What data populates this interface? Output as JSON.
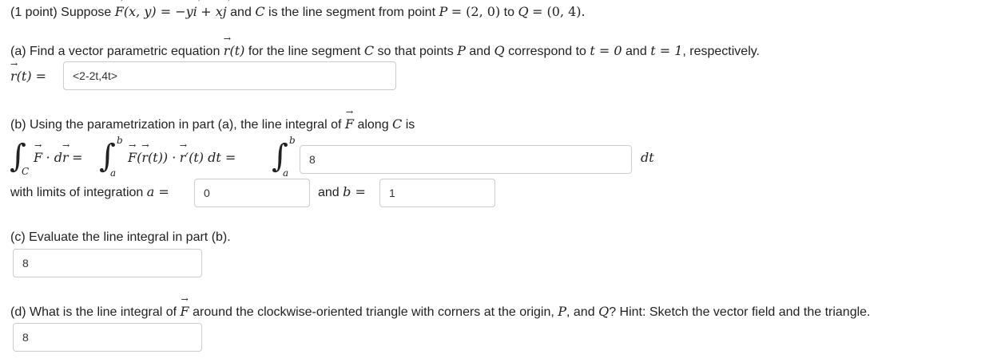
{
  "intro": {
    "points": "(1 point)",
    "suppose": "Suppose",
    "field": "F",
    "field_args": "(x, y) = −y",
    "i": "i",
    "plus": "+ x",
    "j": "j",
    "and": "and",
    "curve": "C",
    "is_segment": "is the line segment from point",
    "P": "P",
    "p_val": "= (2, 0)",
    "to": "to",
    "Q": "Q",
    "q_val": "= (0, 4)."
  },
  "part_a": {
    "prompt_start": "(a) Find a vector parametric equation",
    "r": "r",
    "t_arg": "(t)",
    "prompt_mid": "for the line segment",
    "curve": "C",
    "prompt_mid2": "so that points",
    "P": "P",
    "and": "and",
    "Q": "Q",
    "prompt_mid3": "correspond to",
    "t0": "t = 0",
    "and2": "and",
    "t1": "t = 1",
    "prompt_end": ", respectively.",
    "answer_label_r": "r",
    "answer_label_rest": "(t) =",
    "answer_value": "<2-2t,4t>"
  },
  "part_b": {
    "prompt_start": "(b) Using the parametrization in part (a), the line integral of",
    "F": "F",
    "prompt_mid": "along",
    "curve": "C",
    "prompt_end": "is",
    "int_sym": "∫",
    "sub_c": "C",
    "F_dot": "F",
    "dot_d": "· d",
    "r_after": "r",
    "eq1": "=",
    "upper_b": "b",
    "lower_a": "a",
    "F2": "F",
    "paren_open": "(",
    "r2": "r",
    "paren_rest": "(t)) ·",
    "r3": "r",
    "prime_rest": "′(t) dt =",
    "integrand_value": "8",
    "dt": "dt",
    "limits_label": "with limits of integration",
    "a_eq": "a =",
    "a_value": "0",
    "and_label": "and",
    "b_eq": "b =",
    "b_value": "1"
  },
  "part_c": {
    "prompt": "(c) Evaluate the line integral in part (b).",
    "answer": "8"
  },
  "part_d": {
    "prompt_start": "(d) What is the line integral of",
    "F": "F",
    "prompt_mid": "around the clockwise-oriented triangle with corners at the origin,",
    "P": "P",
    "comma_and": ", and",
    "Q": "Q",
    "prompt_end": "? Hint: Sketch the vector field and the triangle.",
    "answer": "8"
  }
}
